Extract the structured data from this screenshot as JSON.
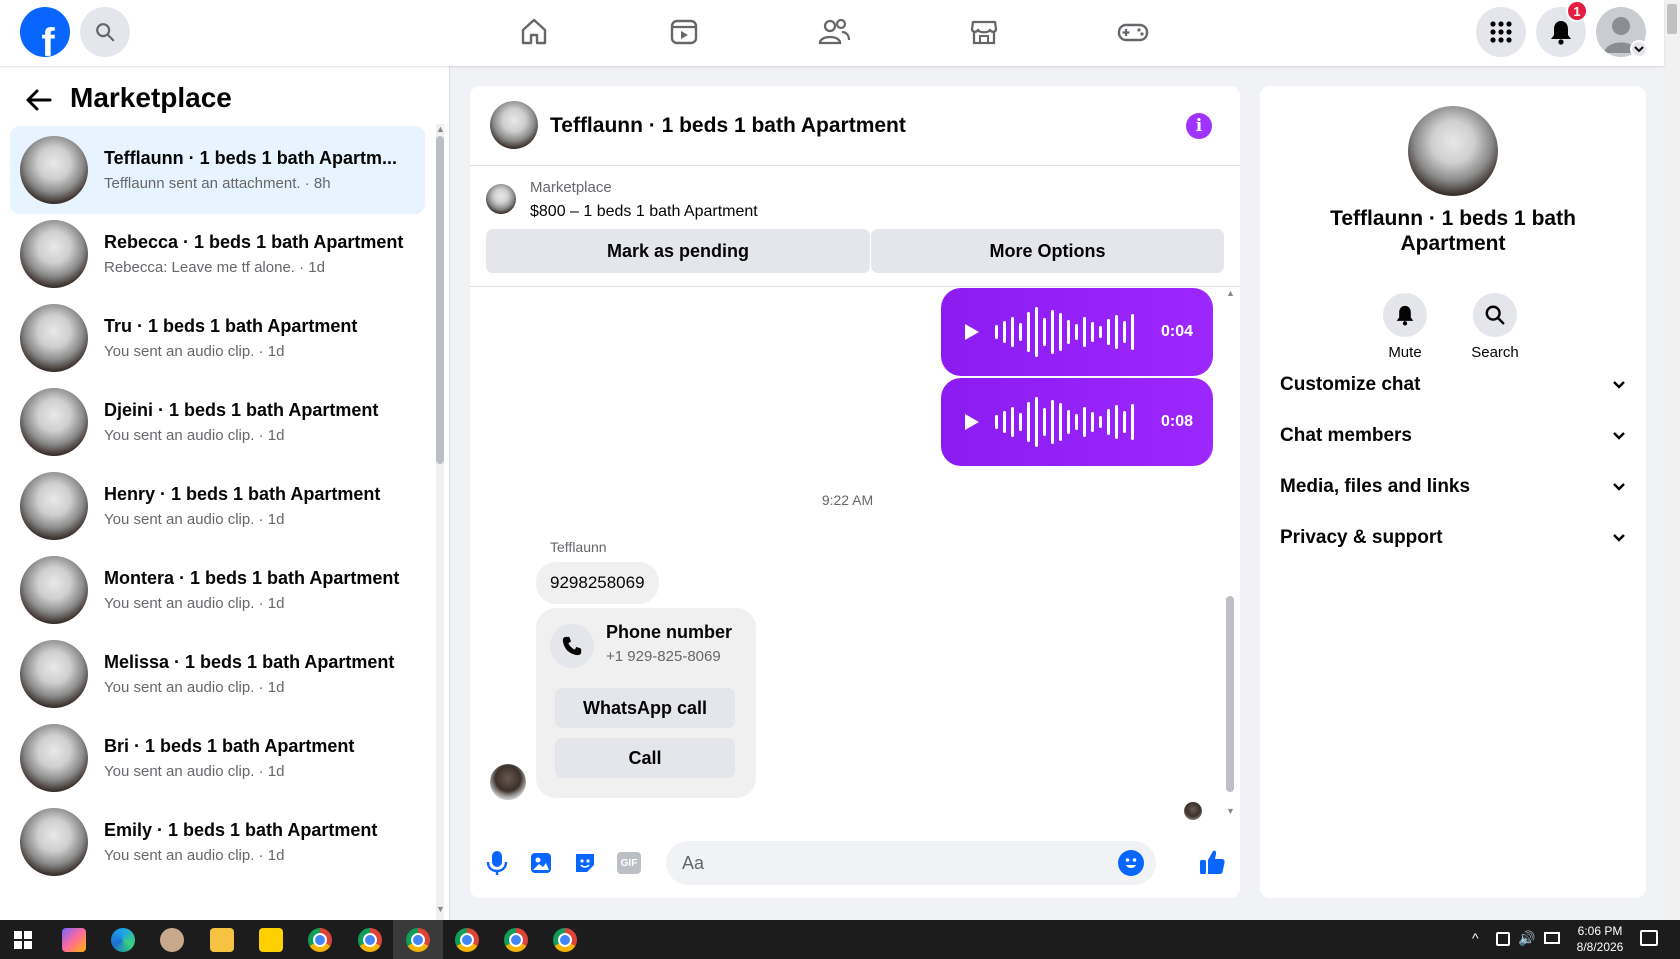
{
  "topbar": {
    "logo": "f",
    "notification_count": "1"
  },
  "sidebar": {
    "title": "Marketplace",
    "conversations": [
      {
        "name": "Tefflaunn · 1 beds 1 bath Apartm...",
        "preview": "Tefflaunn sent an attachment. · 8h",
        "active": true
      },
      {
        "name": "Rebecca · 1 beds 1 bath Apartment",
        "preview": "Rebecca: Leave me tf alone. · 1d"
      },
      {
        "name": "Tru · 1 beds 1 bath Apartment",
        "preview": "You sent an audio clip. · 1d"
      },
      {
        "name": "Djeini · 1 beds 1 bath Apartment",
        "preview": "You sent an audio clip. · 1d"
      },
      {
        "name": "Henry · 1 beds 1 bath Apartment",
        "preview": "You sent an audio clip. · 1d"
      },
      {
        "name": "Montera · 1 beds 1 bath Apartment",
        "preview": "You sent an audio clip. · 1d"
      },
      {
        "name": "Melissa · 1 beds 1 bath Apartment",
        "preview": "You sent an audio clip. · 1d"
      },
      {
        "name": "Bri · 1 beds 1 bath Apartment",
        "preview": "You sent an audio clip. · 1d"
      },
      {
        "name": "Emily · 1 beds 1 bath Apartment",
        "preview": "You sent an audio clip. · 1d"
      }
    ]
  },
  "chat": {
    "title": "Tefflaunn · 1 beds 1 bath Apartment",
    "listing_label": "Marketplace",
    "listing_title": "$800 – 1 beds 1 bath Apartment",
    "mark_pending": "Mark as pending",
    "more_options": "More Options",
    "audio_clips": [
      {
        "duration": "0:04"
      },
      {
        "duration": "0:08"
      }
    ],
    "timestamp": "9:22 AM",
    "sender": "Tefflaunn",
    "message": "9298258069",
    "phone_card": {
      "title": "Phone number",
      "number": "+1 929-825-8069",
      "whatsapp": "WhatsApp call",
      "call": "Call"
    },
    "composer_placeholder": "Aa"
  },
  "info": {
    "name": "Tefflaunn · 1 beds 1 bath Apartment",
    "mute": "Mute",
    "search": "Search",
    "sections": [
      "Customize chat",
      "Chat members",
      "Media, files and links",
      "Privacy & support"
    ]
  },
  "taskbar": {
    "time": "6:06 PM",
    "date": "8/8/2026"
  },
  "colors": {
    "brand": "#0866ff",
    "audio_purple": "#9d27ff",
    "info_icon": "#a033ff",
    "badge_red": "#e41e3f"
  }
}
